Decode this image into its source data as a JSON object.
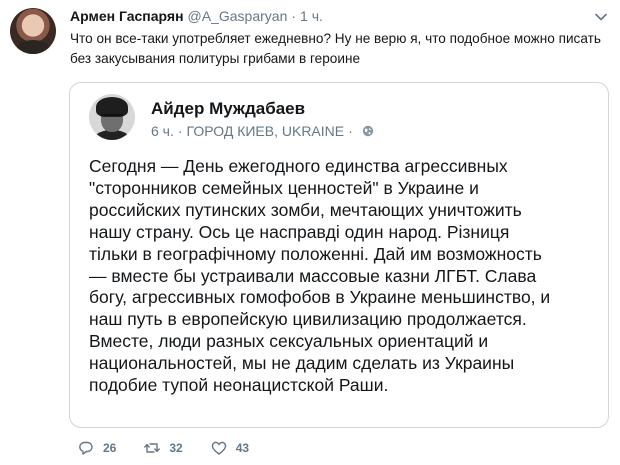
{
  "tweet": {
    "author_name": "Армен Гаспарян",
    "handle": "@A_Gasparyan",
    "separator": "·",
    "time": "1 ч.",
    "text": "Что он все-таки употребляет ежедневно? Ну не верю я, что подобное можно писать без закусывания политуры грибами в героине",
    "caret_icon": "chevron-down-icon"
  },
  "quoted_tweet": {
    "author_name": "Айдер Муждабаев",
    "time": "6 ч.",
    "separator": "·",
    "location": "ГОРОД КИЕВ, UKRAINE",
    "location_separator": "·",
    "globe_icon": "globe-icon",
    "text": "Сегодня — День ежегодного единства агрессивных\n\"сторонников семейных ценностей\" в Украине и\nроссийских путинских зомби, мечтающих уничтожить\nнашу страну. Ось це насправді один народ. Різниця\nтільки в географічному положенні. Дай им возможность\n— вместе бы устраивали массовые казни ЛГБТ. Слава\nбогу, агрессивных гомофобов в Украине меньшинство, и\nнаш путь в европейскую цивилизацию продолжается.\nВместе, люди разных сексуальных ориентаций и\nнациональностей, мы не дадим сделать из Украины\nподобие тупой неонацистской Раши."
  },
  "actions": {
    "reply_count": "26",
    "retweet_count": "32",
    "like_count": "43"
  },
  "colors": {
    "secondary_text": "#657786",
    "border": "#ccd6dd",
    "primary_text": "#14171a"
  }
}
